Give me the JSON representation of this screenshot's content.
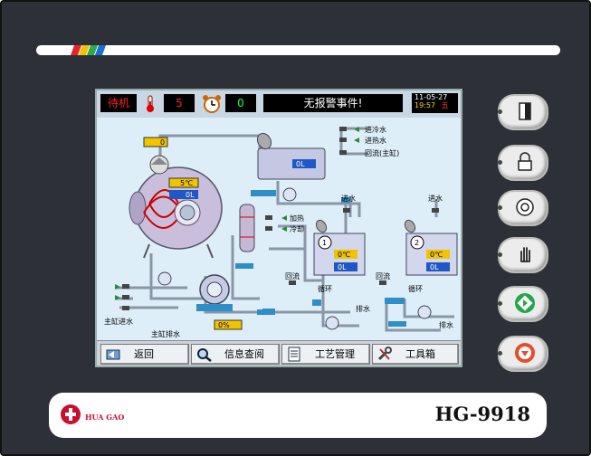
{
  "panel": {
    "brand": "HUA GAO",
    "model": "HG-9918",
    "colors": {
      "bezel": "#2d3137",
      "screen_bg": "#ddeef8",
      "accent_red": "#c8102e",
      "accent_green": "#21a64a"
    }
  },
  "status_bar": {
    "mode": "待机",
    "temperature_value": "5",
    "timer_value": "0",
    "alarm_message": "无报警事件!",
    "date": "11-05-27",
    "time": "19:57",
    "weekday": "五",
    "icons": [
      "thermometer-icon",
      "alarm-clock-icon"
    ]
  },
  "diagram": {
    "top_display": "0",
    "main_tank_temp": "5℃",
    "main_tank_level": "0L",
    "aux_tank_level": "0L",
    "pump_output": "0%",
    "inlets": [
      "进冷水",
      "进热水",
      "回流(主缸)"
    ],
    "heat_labels": [
      "加热",
      "冷却"
    ],
    "main_labels": [
      "主缸进水",
      "主缸排水"
    ],
    "tank1": {
      "number": "1",
      "temp": "0℃",
      "level": "0L",
      "inlet": "进水",
      "return": "回流",
      "circulate": "循环",
      "drain": "排水"
    },
    "tank2": {
      "number": "2",
      "temp": "0℃",
      "level": "0L",
      "inlet": "进水",
      "return": "回流",
      "circulate": "循环",
      "drain": "排水"
    }
  },
  "nav": [
    {
      "label": "返回",
      "icon": "return-icon"
    },
    {
      "label": "信息查阅",
      "icon": "magnifier-icon"
    },
    {
      "label": "工艺管理",
      "icon": "document-icon"
    },
    {
      "label": "工具箱",
      "icon": "tools-icon"
    }
  ],
  "hardware_buttons": [
    "door-icon",
    "lock-icon",
    "speaker-icon",
    "hand-stop-icon",
    "start-icon",
    "stop-icon"
  ]
}
